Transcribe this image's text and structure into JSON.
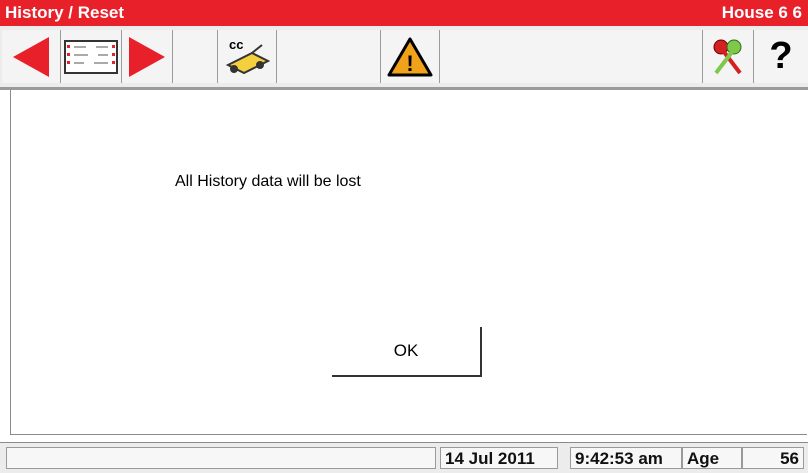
{
  "titlebar": {
    "title": "History / Reset",
    "house": "House 6 6"
  },
  "toolbar": {
    "icons": [
      "previous-arrow-icon",
      "ticket-icon",
      "next-arrow-icon",
      "cc-tractor-icon",
      "warning-icon",
      "keys-icon",
      "help-icon"
    ],
    "cc_label": "cc",
    "help_label": "?",
    "warning_label": "!"
  },
  "dialog": {
    "message": "All History data will be lost",
    "ok_label": "OK"
  },
  "status": {
    "date": "14 Jul 2011",
    "time": "9:42:53 am",
    "age_label": "Age",
    "age_value": "56"
  },
  "colors": {
    "titlebar": "#e8202a",
    "arrow": "#e8202a",
    "warning": "#f0a21a"
  }
}
